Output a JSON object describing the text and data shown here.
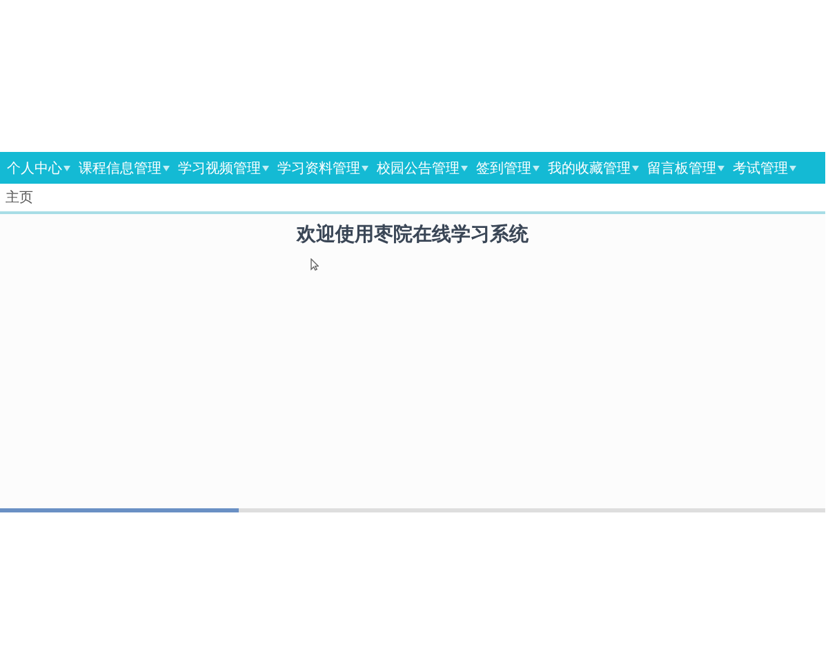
{
  "nav": {
    "items": [
      {
        "label": "个人中心",
        "selected": false
      },
      {
        "label": "课程信息管理",
        "selected": false
      },
      {
        "label": "学习视频管理",
        "selected": false
      },
      {
        "label": "学习资料管理",
        "selected": false
      },
      {
        "label": "校园公告管理",
        "selected": false
      },
      {
        "label": "签到管理",
        "selected": false
      },
      {
        "label": "我的收藏管理",
        "selected": false
      },
      {
        "label": "留言板管理",
        "selected": false
      },
      {
        "label": "考试管理",
        "selected": false
      }
    ]
  },
  "breadcrumb": "主页",
  "welcome_title": "欢迎使用枣院在线学习系统",
  "playback": {
    "level": 0.29
  }
}
